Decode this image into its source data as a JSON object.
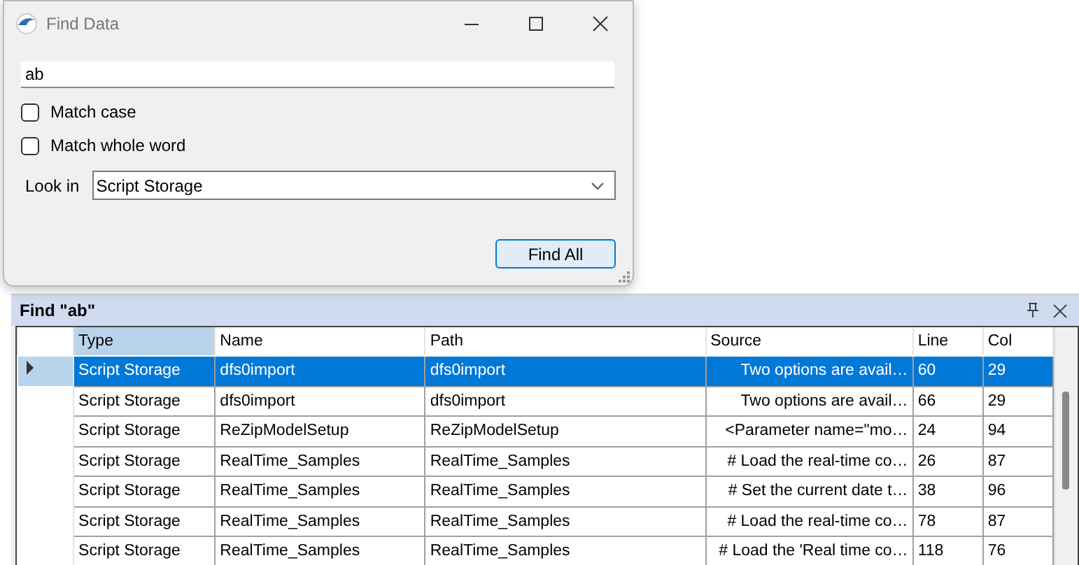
{
  "dialog": {
    "title": "Find Data",
    "search": {
      "value": "ab"
    },
    "options": [
      {
        "label": "Match case",
        "checked": false
      },
      {
        "label": "Match whole word",
        "checked": false
      }
    ],
    "look_in": {
      "label": "Look in",
      "value": "Script Storage"
    },
    "button": "Find All"
  },
  "results": {
    "title": "Find \"ab\"",
    "columns": [
      "Type",
      "Name",
      "Path",
      "Source",
      "Line",
      "Col"
    ],
    "rows": [
      {
        "selected": true,
        "cells": [
          "Script Storage",
          "dfs0import",
          "dfs0import",
          "Two options are avail…",
          "60",
          "29"
        ]
      },
      {
        "selected": false,
        "cells": [
          "Script Storage",
          "dfs0import",
          "dfs0import",
          "Two options are avail…",
          "66",
          "29"
        ]
      },
      {
        "selected": false,
        "cells": [
          "Script Storage",
          "ReZipModelSetup",
          "ReZipModelSetup",
          "<Parameter name=\"mo…",
          "24",
          "94"
        ]
      },
      {
        "selected": false,
        "cells": [
          "Script Storage",
          "RealTime_Samples",
          "RealTime_Samples",
          "# Load the real-time co…",
          "26",
          "87"
        ]
      },
      {
        "selected": false,
        "cells": [
          "Script Storage",
          "RealTime_Samples",
          "RealTime_Samples",
          "# Set the current date t…",
          "38",
          "96"
        ]
      },
      {
        "selected": false,
        "cells": [
          "Script Storage",
          "RealTime_Samples",
          "RealTime_Samples",
          "# Load the real-time co…",
          "78",
          "87"
        ]
      },
      {
        "selected": false,
        "cells": [
          "Script Storage",
          "RealTime_Samples",
          "RealTime_Samples",
          "# Load the 'Real time co…",
          "118",
          "76"
        ]
      }
    ]
  }
}
